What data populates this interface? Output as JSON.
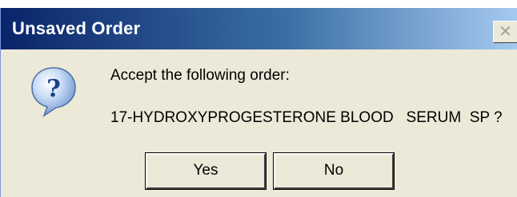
{
  "window": {
    "title": "Unsaved Order",
    "close_glyph": "✕"
  },
  "icon": "question-icon",
  "message": {
    "line1": "Accept the following order:",
    "line2": "17-HYDROXYPROGESTERONE BLOOD   SERUM  SP ?"
  },
  "buttons": {
    "yes_label": "Yes",
    "no_label": "No"
  },
  "colors": {
    "titlebar_start": "#0a246a",
    "titlebar_end": "#a6caf0",
    "dialog_background": "#ece9d8"
  }
}
